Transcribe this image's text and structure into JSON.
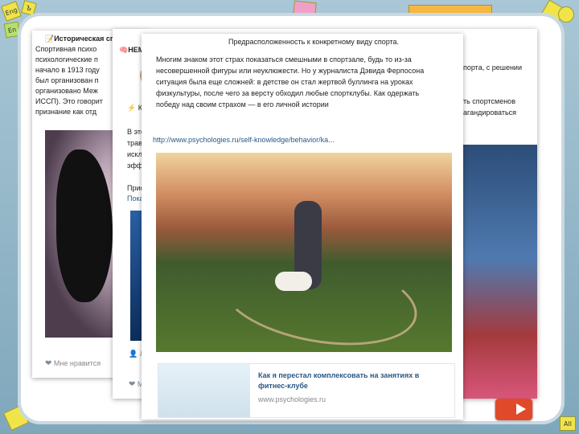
{
  "deco_labels": [
    "Eng",
    "Ъ",
    "En",
    "",
    "",
    "",
    "",
    "",
    "All"
  ],
  "card1": {
    "header": "📝Историческая справка",
    "lines": [
      "Спортивная психо",
      "психологические п",
      "начало в 1913 году",
      "был организован п",
      "организовано Меж",
      "ИССП). Это говорит",
      "признание как отд"
    ],
    "like": "Мне нравится"
  },
  "card2": {
    "header": "🧠НЕМНОГО ТЕОРИИ...",
    "lines": [
      "⚡ Ка",
      "В этой",
      "травм",
      "исклю",
      "эффе",
      "Присо",
      "Показ"
    ],
    "right_lines": [
      "порта, с решении",
      "ть спортсменов",
      "агандироваться"
    ],
    "author": "Ле",
    "like": "М"
  },
  "card3": {
    "title": "Предрасположенность к конкретному виду спорта.",
    "body": [
      "Многим знаком этот страх показаться смешными в спортзале, будь то из-за",
      "несовершенной фигуры или неуклюжести. Но у журналиста Дэвида Ферпосона",
      "ситуация была еще сложней: в детстве он стал жертвой буллинга на уроках",
      "физкультуры, после чего за версту обходил любые спортклубы. Как одержать",
      "победу над своим страхом — в его личной истории"
    ],
    "url": "http://www.psychologies.ru/self-knowledge/behavior/ka...",
    "link_title": [
      "Как я перестал комплексовать на занятиях в",
      "фитнес-клубе"
    ],
    "link_domain": "www.psychologies.ru"
  },
  "nav": {
    "next": "next-slide"
  }
}
